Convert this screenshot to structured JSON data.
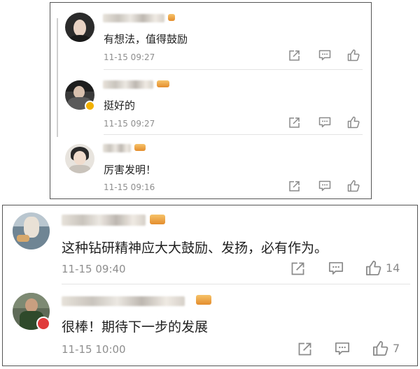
{
  "top_panel": {
    "comments": [
      {
        "text": "有想法，值得鼓励",
        "time": "11-15 09:27"
      },
      {
        "text": "挺好的",
        "time": "11-15 09:27"
      },
      {
        "text": "厉害发明！",
        "time": "11-15 09:16"
      }
    ]
  },
  "bottom_panel": {
    "comments": [
      {
        "text": "这种钻研精神应大大鼓励、发扬，必有作为。",
        "time": "11-15 09:40",
        "likes": "14"
      },
      {
        "text": "很棒！期待下一步的发展",
        "time": "11-15 10:00",
        "likes": "7"
      }
    ]
  },
  "icons": [
    "share-icon",
    "comment-icon",
    "like-icon"
  ],
  "colors": {
    "border": "#555555",
    "meta": "#8e8e8e",
    "verified_badge": "#f2b100",
    "red_badge": "#e03b3b",
    "vip": "#e48d2d"
  }
}
